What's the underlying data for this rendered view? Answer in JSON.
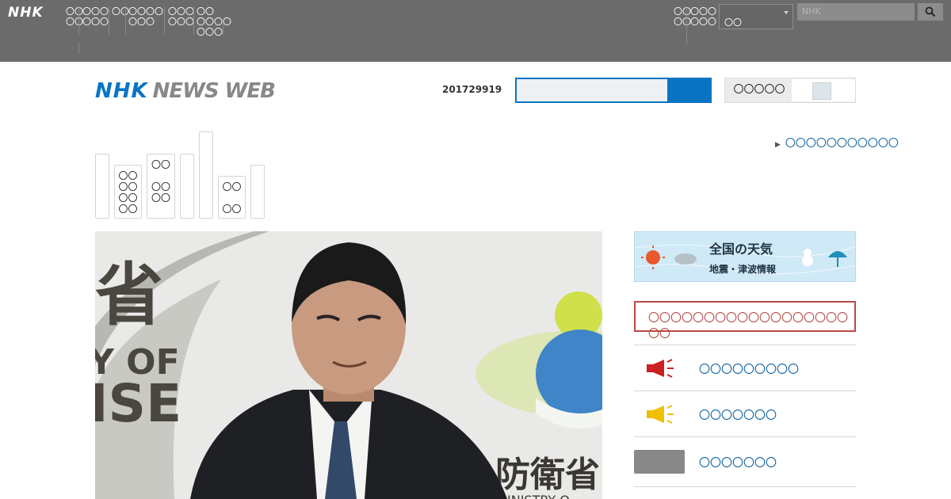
{
  "topbar": {
    "logo": "NHK",
    "nav": [
      "〇〇\n〇〇",
      "〇〇〇\n〇〇〇",
      "〇〇",
      "〇〇〇〇\n〇〇〇",
      "〇〇〇\n〇〇〇",
      "〇〇\n〇〇〇〇\n〇〇〇"
    ],
    "right_links": [
      "〇〇\n〇〇",
      "〇〇〇\n〇〇〇"
    ],
    "select_value": "〇〇",
    "search_placeholder": "NHK",
    "search_icon": "search-icon"
  },
  "header": {
    "brand_nhk": "NHK",
    "brand_news": "NEWS WEB",
    "date": "201729919",
    "toggle_label": "〇〇〇〇〇"
  },
  "category_nav": [
    "",
    "〇〇\n〇〇\n〇〇\n〇〇",
    "〇〇\n\n〇〇\n〇〇",
    "",
    "",
    "〇〇\n\n〇〇",
    ""
  ],
  "more_link": "〇〇〇〇〇〇〇〇〇〇〇",
  "hero": {
    "sign_text_1": "省",
    "sign_text_2": "Y OF",
    "sign_text_3": "ISE",
    "sign_text_4": "防衛省",
    "sign_text_5": "INISTRY O"
  },
  "sidebar": {
    "weather_title": "全国の天気",
    "weather_sub": "地震・津波情報",
    "alert": "〇〇〇〇〇〇〇〇〇〇〇〇〇〇〇〇〇〇〇〇",
    "items": [
      {
        "label": "〇〇〇〇〇〇〇〇〇",
        "icon": "megaphone-icon",
        "color": "#cc1f1f"
      },
      {
        "label": "〇〇〇〇〇〇〇",
        "icon": "megaphone-icon",
        "color": "#f0c000"
      },
      {
        "label": "〇〇〇〇〇〇〇",
        "icon": "thumbnail-placeholder",
        "color": "#888888"
      }
    ]
  },
  "colors": {
    "topbar": "#6b6b6b",
    "brand_blue": "#0a74c4",
    "link": "#0a5f9e",
    "alert_red": "#b84a44"
  }
}
